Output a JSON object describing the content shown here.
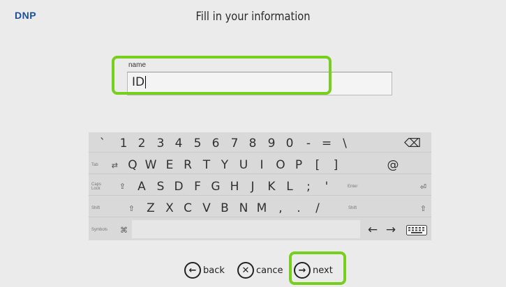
{
  "header": {
    "brand": "DNP",
    "title": "Fill in your information"
  },
  "form": {
    "label": "name",
    "value": "ID"
  },
  "keyboard": {
    "rows": [
      [
        "`",
        "1",
        "2",
        "3",
        "4",
        "5",
        "6",
        "7",
        "8",
        "9",
        "0",
        "-",
        "=",
        "\\"
      ],
      [
        "Q",
        "W",
        "E",
        "R",
        "T",
        "Y",
        "U",
        "I",
        "O",
        "P",
        "[",
        "]",
        "@"
      ],
      [
        "A",
        "S",
        "D",
        "F",
        "G",
        "H",
        "J",
        "K",
        "L",
        ";",
        "'"
      ],
      [
        "Z",
        "X",
        "C",
        "V",
        "B",
        "N",
        "M",
        ",",
        ".",
        "/"
      ]
    ],
    "tab": "Tab",
    "caps": "Caps Lock",
    "enter": "Enter",
    "shift": "Shift",
    "symbols": "Symbols",
    "icons": {
      "backspace": "⌫",
      "tab": "⇄",
      "caps": "⇪",
      "enter": "⏎",
      "shift": "⇧",
      "cmd": "⌘",
      "left": "←",
      "right": "→",
      "keyboard": "keyboard-icon"
    }
  },
  "nav": {
    "back": "back",
    "cancel": "cance",
    "next": "next"
  },
  "colors": {
    "highlight": "#77cf1d",
    "brand": "#1b4f9c"
  }
}
